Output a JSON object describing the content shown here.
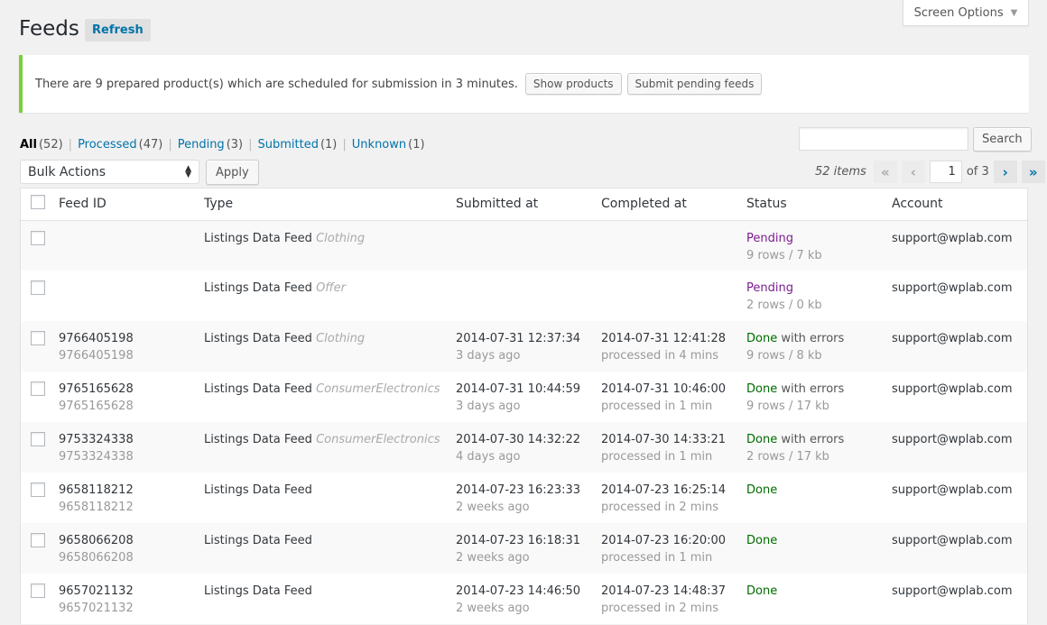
{
  "screen_options": {
    "label": "Screen Options"
  },
  "page": {
    "title": "Feeds",
    "refresh_label": "Refresh"
  },
  "notice": {
    "text": "There are 9 prepared product(s) which are scheduled for submission in 3 minutes.",
    "show_products_label": "Show products",
    "submit_pending_label": "Submit pending feeds"
  },
  "filters": [
    {
      "label": "All",
      "count": "(52)"
    },
    {
      "label": "Processed",
      "count": "(47)"
    },
    {
      "label": "Pending",
      "count": "(3)"
    },
    {
      "label": "Submitted",
      "count": "(1)"
    },
    {
      "label": "Unknown",
      "count": "(1)"
    }
  ],
  "search": {
    "value": "",
    "button_label": "Search"
  },
  "bulk": {
    "selected": "Bulk Actions",
    "apply_label": "Apply"
  },
  "pagination": {
    "items": "52 items",
    "first": "«",
    "prev": "‹",
    "current": "1",
    "of_total": "of 3",
    "next": "›",
    "last": "»"
  },
  "columns": [
    "Feed ID",
    "Type",
    "Submitted at",
    "Completed at",
    "Status",
    "Account"
  ],
  "colors": {
    "accent": "#0073aa",
    "notice_border": "#7ad03a",
    "pending": "#7b1e8f",
    "done": "#006b00"
  },
  "rows": [
    {
      "feed_id": "",
      "feed_id_sub": "",
      "type": "Listings Data Feed",
      "type_extra": "Clothing",
      "submitted": "",
      "submitted_sub": "",
      "completed": "",
      "completed_sub": "",
      "status": "Pending",
      "status_kind": "pending",
      "status_suffix": "",
      "status_sub": "9 rows / 7 kb",
      "account": "support@wplab.com"
    },
    {
      "feed_id": "",
      "feed_id_sub": "",
      "type": "Listings Data Feed",
      "type_extra": "Offer",
      "submitted": "",
      "submitted_sub": "",
      "completed": "",
      "completed_sub": "",
      "status": "Pending",
      "status_kind": "pending",
      "status_suffix": "",
      "status_sub": "2 rows / 0 kb",
      "account": "support@wplab.com"
    },
    {
      "feed_id": "9766405198",
      "feed_id_sub": "9766405198",
      "type": "Listings Data Feed",
      "type_extra": "Clothing",
      "submitted": "2014-07-31 12:37:34",
      "submitted_sub": "3 days ago",
      "completed": "2014-07-31 12:41:28",
      "completed_sub": "processed in 4 mins",
      "status": "Done",
      "status_kind": "done",
      "status_suffix": " with errors",
      "status_sub": "9 rows / 8 kb",
      "account": "support@wplab.com"
    },
    {
      "feed_id": "9765165628",
      "feed_id_sub": "9765165628",
      "type": "Listings Data Feed",
      "type_extra": "ConsumerElectronics",
      "submitted": "2014-07-31 10:44:59",
      "submitted_sub": "3 days ago",
      "completed": "2014-07-31 10:46:00",
      "completed_sub": "processed in 1 min",
      "status": "Done",
      "status_kind": "done",
      "status_suffix": " with errors",
      "status_sub": "9 rows / 17 kb",
      "account": "support@wplab.com"
    },
    {
      "feed_id": "9753324338",
      "feed_id_sub": "9753324338",
      "type": "Listings Data Feed",
      "type_extra": "ConsumerElectronics",
      "submitted": "2014-07-30 14:32:22",
      "submitted_sub": "4 days ago",
      "completed": "2014-07-30 14:33:21",
      "completed_sub": "processed in 1 min",
      "status": "Done",
      "status_kind": "done",
      "status_suffix": " with errors",
      "status_sub": "2 rows / 17 kb",
      "account": "support@wplab.com"
    },
    {
      "feed_id": "9658118212",
      "feed_id_sub": "9658118212",
      "type": "Listings Data Feed",
      "type_extra": "",
      "submitted": "2014-07-23 16:23:33",
      "submitted_sub": "2 weeks ago",
      "completed": "2014-07-23 16:25:14",
      "completed_sub": "processed in 2 mins",
      "status": "Done",
      "status_kind": "done",
      "status_suffix": "",
      "status_sub": "",
      "account": "support@wplab.com"
    },
    {
      "feed_id": "9658066208",
      "feed_id_sub": "9658066208",
      "type": "Listings Data Feed",
      "type_extra": "",
      "submitted": "2014-07-23 16:18:31",
      "submitted_sub": "2 weeks ago",
      "completed": "2014-07-23 16:20:00",
      "completed_sub": "processed in 1 min",
      "status": "Done",
      "status_kind": "done",
      "status_suffix": "",
      "status_sub": "",
      "account": "support@wplab.com"
    },
    {
      "feed_id": "9657021132",
      "feed_id_sub": "9657021132",
      "type": "Listings Data Feed",
      "type_extra": "",
      "submitted": "2014-07-23 14:46:50",
      "submitted_sub": "2 weeks ago",
      "completed": "2014-07-23 14:48:37",
      "completed_sub": "processed in 2 mins",
      "status": "Done",
      "status_kind": "done",
      "status_suffix": "",
      "status_sub": "",
      "account": "support@wplab.com"
    }
  ]
}
